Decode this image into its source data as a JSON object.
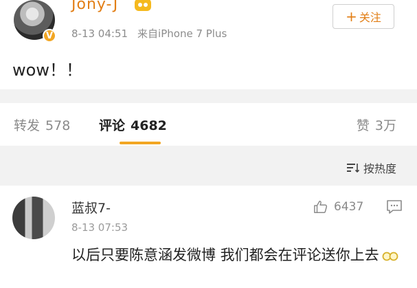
{
  "post": {
    "author": "Jony-J",
    "time": "8-13 04:51",
    "source": "来自iPhone 7 Plus",
    "follow_label": "关注",
    "content": "wow！！",
    "verified_badge": "V"
  },
  "stats": {
    "repost_label": "转发",
    "repost_count": "578",
    "comment_label": "评论",
    "comment_count": "4682",
    "like_label": "赞",
    "like_count": "3万"
  },
  "sort": {
    "label": "按热度"
  },
  "comment": {
    "user": "蓝叔7-",
    "time": "8-13 07:53",
    "likes": "6437",
    "text": "以后只要陈意涵发微博 我们都会在评论送你上去"
  },
  "colors": {
    "accent": "#e27e15",
    "underline": "#f2a623",
    "background": "#f2f2f2"
  }
}
